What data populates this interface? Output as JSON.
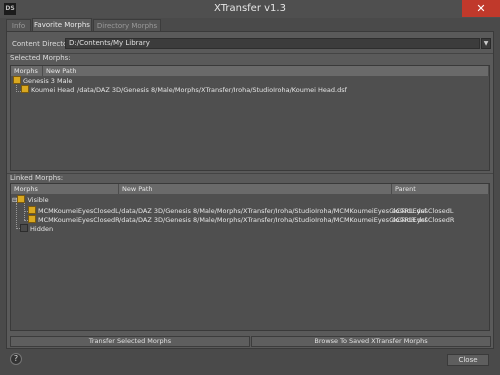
{
  "window": {
    "title": "XTransfer v1.3",
    "app_icon_text": "DS",
    "close_glyph": "✕"
  },
  "tabs": [
    {
      "label": "Info",
      "active": false
    },
    {
      "label": "Favorite Morphs",
      "active": true
    },
    {
      "label": "Directory Morphs",
      "active": false
    }
  ],
  "content_directory": {
    "label": "Content Directory:",
    "value": "D:/Contents/My Library",
    "dropdown_glyph": "▼"
  },
  "selected_morphs": {
    "section_label": "Selected Morphs:",
    "headers": [
      "Morphs",
      "New Path"
    ],
    "rows": [
      {
        "name": "Genesis 3 Male",
        "path": "",
        "checked": true
      },
      {
        "name": "Koumei Head",
        "path": "/data/DAZ 3D/Genesis 8/Male/Morphs/XTransfer/Iroha/StudioIroha/Koumei Head.dsf",
        "checked": true
      }
    ]
  },
  "linked_morphs": {
    "section_label": "Linked Morphs:",
    "headers": [
      "Morphs",
      "New Path",
      "Parent"
    ],
    "rows": [
      {
        "name": "Visible",
        "path": "",
        "parent": "",
        "checked": true
      },
      {
        "name": "MCMKoumeiEyesClosedL",
        "path": "/data/DAZ 3D/Genesis 8/Male/Morphs/XTransfer/Iroha/StudioIroha/MCMKoumeiEyesClosedL.dsf",
        "parent": "eCTRLEyesClosedL",
        "checked": true
      },
      {
        "name": "MCMKoumeiEyesClosedR",
        "path": "/data/DAZ 3D/Genesis 8/Male/Morphs/XTransfer/Iroha/StudioIroha/MCMKoumeiEyesClosedR.dsf",
        "parent": "eCTRLEyesClosedR",
        "checked": true
      },
      {
        "name": "Hidden",
        "path": "",
        "parent": "",
        "checked": false
      }
    ],
    "expander_glyph": "⊟"
  },
  "buttons": {
    "transfer": "Transfer Selected Morphs",
    "browse": "Browse To Saved XTransfer Morphs",
    "close": "Close",
    "help": "?"
  }
}
